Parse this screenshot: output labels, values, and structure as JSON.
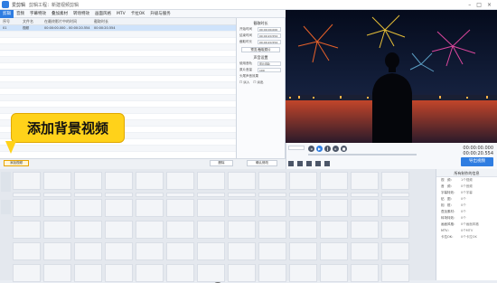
{
  "window": {
    "app_title": "爱剪辑",
    "doc_title": "剪辑工程：新建视频剪辑"
  },
  "menu": {
    "items": [
      "剪辑",
      "音频",
      "字幕特效",
      "叠加素材",
      "转场特效",
      "画面风格",
      "MTV",
      "卡拉OK",
      "升级与服务"
    ],
    "active_index": 0
  },
  "list": {
    "headers": [
      "序号",
      "文件名",
      "在最终影片中的时间",
      "截取时长"
    ],
    "rows": [
      {
        "no": "01",
        "name": "视频",
        "time": "00:00:00.000 - 00:00:20.554",
        "dur": "00:00:20.554"
      }
    ]
  },
  "clip_panel": {
    "title": "截取时长",
    "rows": [
      {
        "label": "开始时间",
        "value": "00:00:00.000"
      },
      {
        "label": "结束时间",
        "value": "00:00:20.554"
      },
      {
        "label": "截取时长",
        "value": "00:00:20.554"
      }
    ],
    "btn": "预览/截取原片",
    "sound_title": "声音设置",
    "sound_rows": [
      {
        "label": "使用音轨",
        "value": "原片音轨"
      },
      {
        "label": "原片音量",
        "value": "100"
      }
    ],
    "fade_label": "头尾声音效果",
    "fade_in": "淡入",
    "fade_out": "淡出"
  },
  "bottom": {
    "add_bg": "添加视频",
    "delete": "删除",
    "confirm": "确认修改"
  },
  "callout": {
    "text": "添加背景视频"
  },
  "controls": {
    "time_current": "00:00:00.000",
    "time_total": "00:00:20.554",
    "export": "导出视频"
  },
  "timeline": {
    "first_clip_label": "视频"
  },
  "props": {
    "title": "所有制作的信息",
    "rows": [
      {
        "k": "视　频：",
        "v": "1个视频"
      },
      {
        "k": "音　频：",
        "v": "0个音频"
      },
      {
        "k": "字幕特效：",
        "v": "0个字幕"
      },
      {
        "k": "贴　图：",
        "v": "0个"
      },
      {
        "k": "相　框：",
        "v": "0个"
      },
      {
        "k": "叠加素材：",
        "v": "0个"
      },
      {
        "k": "转场特效：",
        "v": "0个"
      },
      {
        "k": "画面风格：",
        "v": "0个画面风格"
      },
      {
        "k": "MTV：",
        "v": "0个MTV"
      },
      {
        "k": "卡拉OK：",
        "v": "0个卡拉OK"
      }
    ]
  },
  "colors": {
    "accent": "#2f7de1",
    "callout": "#ffd21a"
  }
}
